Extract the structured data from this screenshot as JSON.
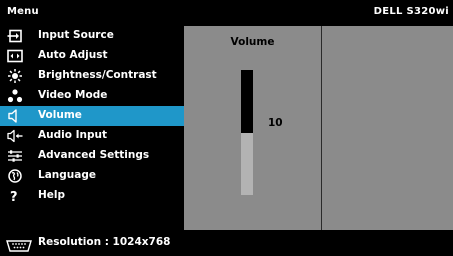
{
  "header": {
    "menu_title": "Menu",
    "model": "DELL S320wi"
  },
  "menu": {
    "selected_index": 4,
    "items": [
      {
        "label": "Input Source",
        "icon": "input-source-icon"
      },
      {
        "label": "Auto Adjust",
        "icon": "auto-adjust-icon"
      },
      {
        "label": "Brightness/Contrast",
        "icon": "brightness-icon"
      },
      {
        "label": "Video Mode",
        "icon": "video-mode-icon"
      },
      {
        "label": "Volume",
        "icon": "volume-icon"
      },
      {
        "label": "Audio Input",
        "icon": "audio-input-icon"
      },
      {
        "label": "Advanced Settings",
        "icon": "advanced-settings-icon"
      },
      {
        "label": "Language",
        "icon": "language-icon"
      },
      {
        "label": "Help",
        "icon": "help-icon"
      }
    ]
  },
  "panel": {
    "title": "Volume",
    "slider_value": "10",
    "slider_fraction": 0.5
  },
  "footer": {
    "resolution_text": "Resolution : 1024x768",
    "icon": "vga-connector-icon"
  },
  "colors": {
    "background": "#000000",
    "selection": "#1f97c9",
    "panel": "#8b8b8b",
    "slider_track": "#b3b3b3",
    "slider_fill": "#000000"
  }
}
